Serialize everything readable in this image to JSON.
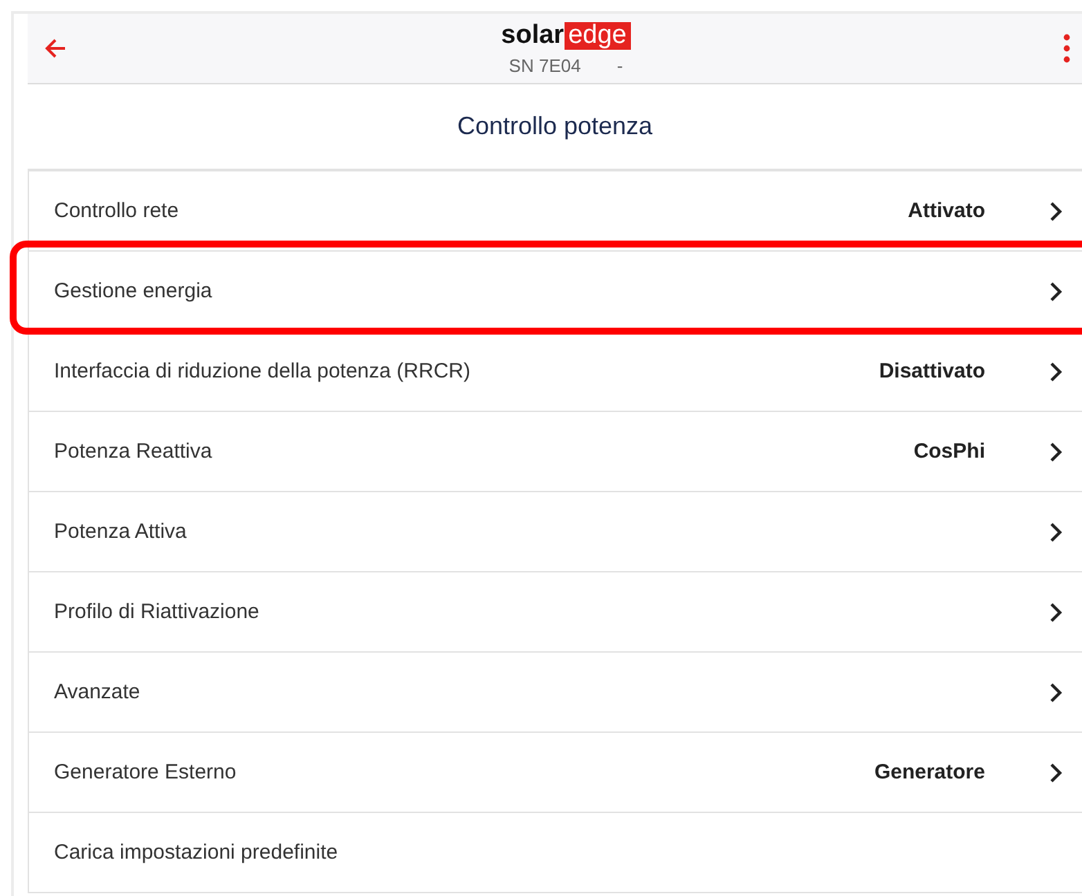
{
  "header": {
    "logo": {
      "plain": "solar",
      "boxed": "edge"
    },
    "serial": "SN 7E04",
    "serial_suffix": "-"
  },
  "page_title": "Controllo potenza",
  "items": [
    {
      "label": "Controllo rete",
      "value": "Attivato",
      "kind": "link",
      "highlighted": false
    },
    {
      "label": "Gestione energia",
      "kind": "link",
      "highlighted": true
    },
    {
      "label": "Interfaccia di riduzione della potenza (RRCR)",
      "value": "Disattivato",
      "kind": "link",
      "highlighted": false
    },
    {
      "label": "Potenza Reattiva",
      "value": "CosPhi",
      "kind": "link",
      "highlighted": false
    },
    {
      "label": "Potenza Attiva",
      "kind": "link",
      "highlighted": false
    },
    {
      "label": "Profilo di Riattivazione",
      "kind": "link",
      "highlighted": false
    },
    {
      "label": "Avanzate",
      "kind": "link",
      "highlighted": false
    },
    {
      "label": "Generatore Esterno",
      "value": "Generatore",
      "kind": "link",
      "highlighted": false
    },
    {
      "label": "Carica impostazioni predefinite",
      "kind": "action",
      "highlighted": false
    }
  ]
}
